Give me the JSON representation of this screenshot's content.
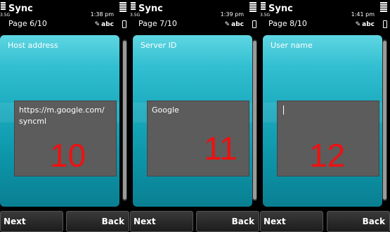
{
  "screens": [
    {
      "app_title": "Sync",
      "page_label": "Page 6/10",
      "clock": "1:38 pm",
      "input_mode": "abc",
      "signal_text": "3.5G",
      "field_label": "Host address",
      "field_value": "https://m.google.com/\nsyncml",
      "step_number": "10",
      "softkey_left": "Next",
      "softkey_right": "Back"
    },
    {
      "app_title": "Sync",
      "page_label": "Page 7/10",
      "clock": "1:39 pm",
      "input_mode": "abc",
      "signal_text": "3.5G",
      "field_label": "Server ID",
      "field_value": "Google",
      "step_number": "11",
      "softkey_left": "Next",
      "softkey_right": "Back"
    },
    {
      "app_title": "Sync",
      "page_label": "Page 8/10",
      "clock": "1:41 pm",
      "input_mode": "abc",
      "signal_text": "3.5G",
      "field_label": "User name",
      "field_value": "",
      "step_number": "12",
      "softkey_left": "Next",
      "softkey_right": "Back"
    }
  ],
  "colors": {
    "background": "#000000",
    "panel_teal": "#1aa9bd",
    "input_box": "#5c5c5c",
    "step_number": "#e11111"
  },
  "icons": [
    "signal-strength-icon",
    "battery-level-icon",
    "pen-input-icon",
    "battery-icon"
  ]
}
